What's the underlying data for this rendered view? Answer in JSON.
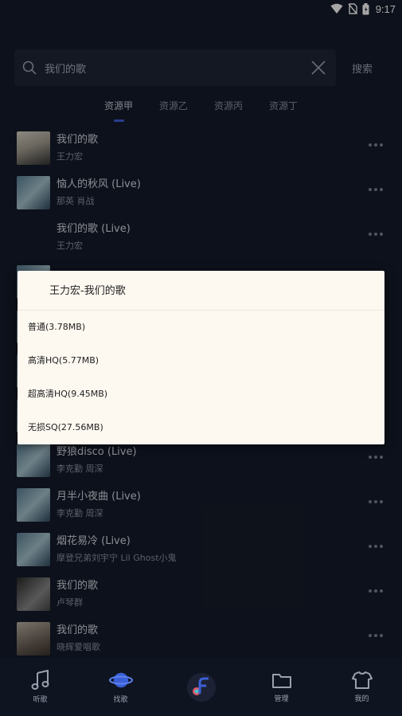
{
  "status_bar": {
    "time": "9:17",
    "icons": [
      "wifi-icon",
      "no-sim-icon",
      "battery-icon"
    ]
  },
  "search": {
    "value": "我们的歌",
    "submit_label": "搜索"
  },
  "tabs": [
    {
      "label": "资源甲",
      "active": true
    },
    {
      "label": "资源乙",
      "active": false
    },
    {
      "label": "资源丙",
      "active": false
    },
    {
      "label": "资源丁",
      "active": false
    }
  ],
  "songs": [
    {
      "title": "我们的歌",
      "artist": "王力宏"
    },
    {
      "title": "恼人的秋风 (Live)",
      "artist": "那英  肖战"
    },
    {
      "title": "我们的歌 (Live)",
      "artist": "王力宏"
    },
    {
      "title": "野狼disco (Live)",
      "artist": "李克勤  周深"
    },
    {
      "title": "月半小夜曲 (Live)",
      "artist": "李克勤  周深"
    },
    {
      "title": "烟花易冷 (Live)",
      "artist": "摩登兄弟刘宇宁  Lil Ghost小鬼"
    },
    {
      "title": "我们的歌",
      "artist": "卢琴群"
    },
    {
      "title": "我们的歌",
      "artist": "晓辉爱唱歌"
    }
  ],
  "dialog": {
    "title": "王力宏-我们的歌",
    "options": [
      "普通(3.78MB)",
      "高清HQ(5.77MB)",
      "超高清HQ(9.45MB)",
      "无损SQ(27.56MB)"
    ]
  },
  "bottom_nav": {
    "items": [
      {
        "label": "听歌",
        "icon": "music-note-icon"
      },
      {
        "label": "找歌",
        "icon": "planet-icon"
      },
      {
        "label": "",
        "icon": "app-logo-icon"
      },
      {
        "label": "管理",
        "icon": "folder-icon"
      },
      {
        "label": "我的",
        "icon": "shirt-icon"
      }
    ]
  },
  "colors": {
    "background": "#151b2a",
    "accent": "#3f5fd8",
    "dialog_bg": "#fdf8f0"
  }
}
